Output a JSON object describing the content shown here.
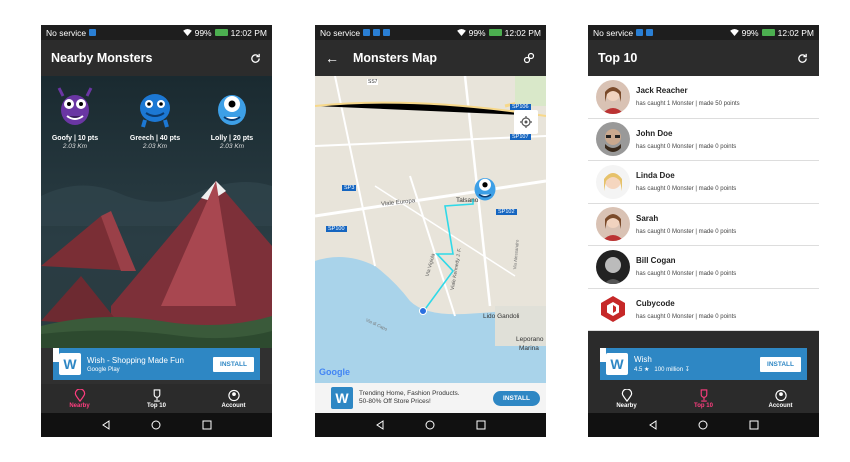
{
  "status": {
    "p1_carrier": "No service",
    "p1_battery": "99%",
    "p1_time": "12:02 PM",
    "p2_carrier": "No service",
    "p2_battery": "99%",
    "p2_time": "12:02 PM",
    "p3_carrier": "No service",
    "p3_battery": "99%",
    "p3_time": "12:02 PM"
  },
  "nearby": {
    "title": "Nearby Monsters",
    "monsters": [
      {
        "name": "Goofy | 10 pts",
        "distance": "2.03 Km",
        "color": "#7b3fb0"
      },
      {
        "name": "Greech | 40 pts",
        "distance": "2.03 Km",
        "color": "#1e7fd8"
      },
      {
        "name": "Lolly | 20 pts",
        "distance": "2.03 Km",
        "color": "#3aa0e8"
      }
    ],
    "ad": {
      "title": "Wish - Shopping Made Fun",
      "subtitle": "Google Play",
      "button": "INSTALL",
      "logo": "W"
    }
  },
  "map": {
    "title": "Monsters Map",
    "labels": {
      "talsano": "Talsano",
      "viale_europa": "Viale Europa",
      "lido": "Lido Gandoli",
      "leporano": "Leporano",
      "marina": "Marina",
      "sp3": "SP3",
      "sp100": "SP100",
      "sp102": "SP102",
      "sp107": "SP107",
      "sp106": "SP106",
      "via_vigiola": "Via Vigiola",
      "via_kennedy": "Viale Kennedy J. F.",
      "via_alessandro": "Via Alessandro",
      "via_capo": "Via di Capo",
      "ss7": "SS7",
      "google": "Google"
    },
    "ad": {
      "line1": "Trending Home, Fashion Products.",
      "line2": "50-80% Off Store Prices!",
      "button": "INSTALL",
      "logo": "W"
    }
  },
  "top10": {
    "title": "Top 10",
    "players": [
      {
        "name": "Jack Reacher",
        "desc": "has caught 1 Monster | made 50 points"
      },
      {
        "name": "John Doe",
        "desc": "has caught 0 Monster | made 0 points"
      },
      {
        "name": "Linda Doe",
        "desc": "has caught 0 Monster | made 0 points"
      },
      {
        "name": "Sarah",
        "desc": "has caught 0 Monster | made 0 points"
      },
      {
        "name": "Bill Cogan",
        "desc": "has caught 0 Monster | made 0 points"
      },
      {
        "name": "Cubycode",
        "desc": "has caught 0 Monster | made 0 points"
      }
    ],
    "ad": {
      "title": "Wish",
      "rating": "4.5 ★",
      "installs": "100 million",
      "button": "INSTALL",
      "logo": "W"
    }
  },
  "bottomnav": {
    "nearby": "Nearby",
    "top10": "Top 10",
    "account": "Account"
  },
  "colors": {
    "accent": "#ff3d7f",
    "ad_blue": "#2e87c4",
    "route": "#2fd9e8"
  }
}
